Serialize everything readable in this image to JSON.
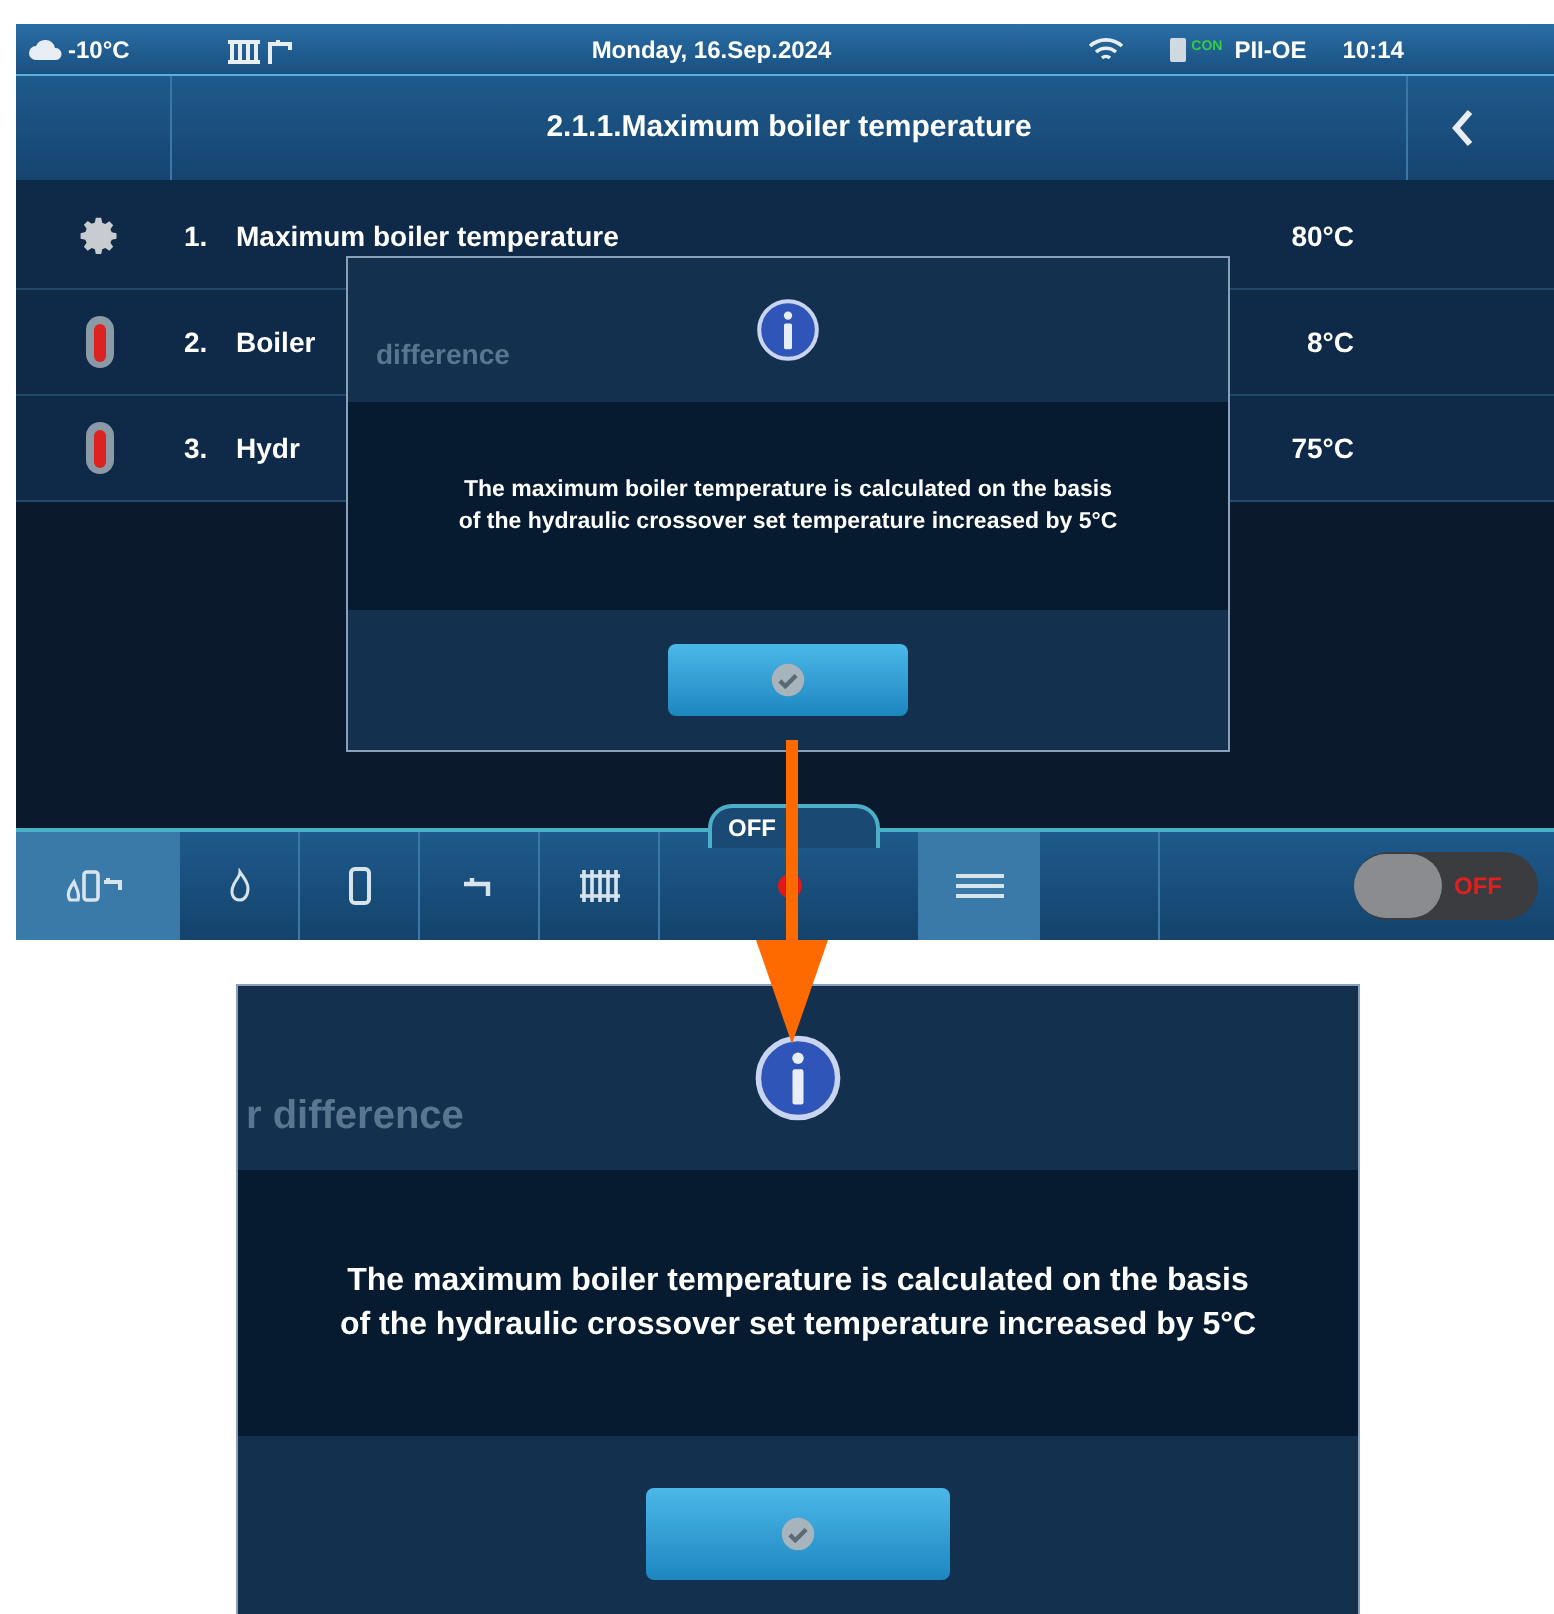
{
  "status_bar": {
    "temperature": "-10°C",
    "date": "Monday, 16.Sep.2024",
    "connection": "CON",
    "device": "PII-OE",
    "time": "10:14"
  },
  "title_bar": {
    "title": "2.1.1.Maximum boiler temperature"
  },
  "rows": [
    {
      "kind": "gear",
      "number": "1.",
      "label": "Maximum boiler temperature",
      "value": "80°C"
    },
    {
      "kind": "thermometer",
      "number": "2.",
      "label": "Boiler",
      "value": "8°C"
    },
    {
      "kind": "thermometer",
      "number": "3.",
      "label": "Hydr",
      "value": "75°C"
    }
  ],
  "dialog": {
    "background_text": "difference",
    "message": [
      "The maximum boiler temperature is calculated on the basis",
      "of the hydraulic crossover set temperature increased by 5°C"
    ]
  },
  "bottom_bar": {
    "mode_label": "OFF",
    "items": [
      {
        "kind": "auto",
        "selected": true
      },
      {
        "kind": "flame",
        "selected": false
      },
      {
        "kind": "boiler",
        "selected": false
      },
      {
        "kind": "tap",
        "selected": false
      },
      {
        "kind": "radiator",
        "selected": false
      },
      {
        "kind": "dot",
        "selected": false
      },
      {
        "kind": "menu",
        "selected": true
      },
      {
        "kind": "blank",
        "selected": false
      }
    ],
    "switch": {
      "label": "OFF",
      "on": false
    }
  },
  "zoom": {
    "background_text": "r difference",
    "message": [
      "The maximum boiler temperature is calculated on the basis",
      "of the hydraulic crossover set temperature increased by 5°C"
    ]
  }
}
